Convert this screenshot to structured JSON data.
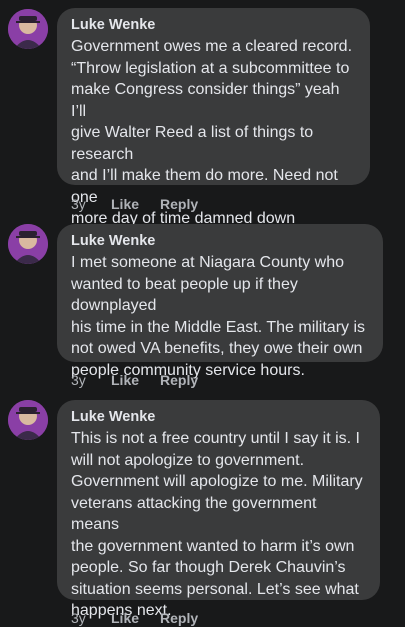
{
  "comments": [
    {
      "author": "Luke Wenke",
      "text": "Government owes me a cleared record.\n“Throw legislation at a subcommittee to\nmake Congress consider things” yeah I’ll\ngive Walter Reed a list of things to research\nand I’ll make them do more.  Need not one\nmore day of time damned down anymore so\nI can get places quicker.",
      "age": "3y",
      "like_label": "Like",
      "reply_label": "Reply"
    },
    {
      "author": "Luke Wenke",
      "text": "I met someone at Niagara County who\nwanted to beat people up if they downplayed\nhis time in the Middle East.  The military is\nnot owed VA benefits, they owe their own\npeople community service hours.",
      "age": "3y",
      "like_label": "Like",
      "reply_label": "Reply"
    },
    {
      "author": "Luke Wenke",
      "text": "This is not a free country until I say it is.  I\nwill not apologize to government.\nGovernment will apologize to me.  Military\nveterans attacking the government means\nthe government wanted to harm it’s own\npeople.  So far though Derek Chauvin’s\nsituation seems personal.  Let’s see what\nhappens next.",
      "age": "3y",
      "like_label": "Like",
      "reply_label": "Reply"
    }
  ],
  "colors": {
    "background": "#18191a",
    "bubble": "#3a3b3c",
    "text": "#e4e6eb",
    "meta": "#b0b3b8",
    "avatar_bg": "#8a3fa6"
  },
  "icons": {
    "avatar": "profile-photo"
  }
}
